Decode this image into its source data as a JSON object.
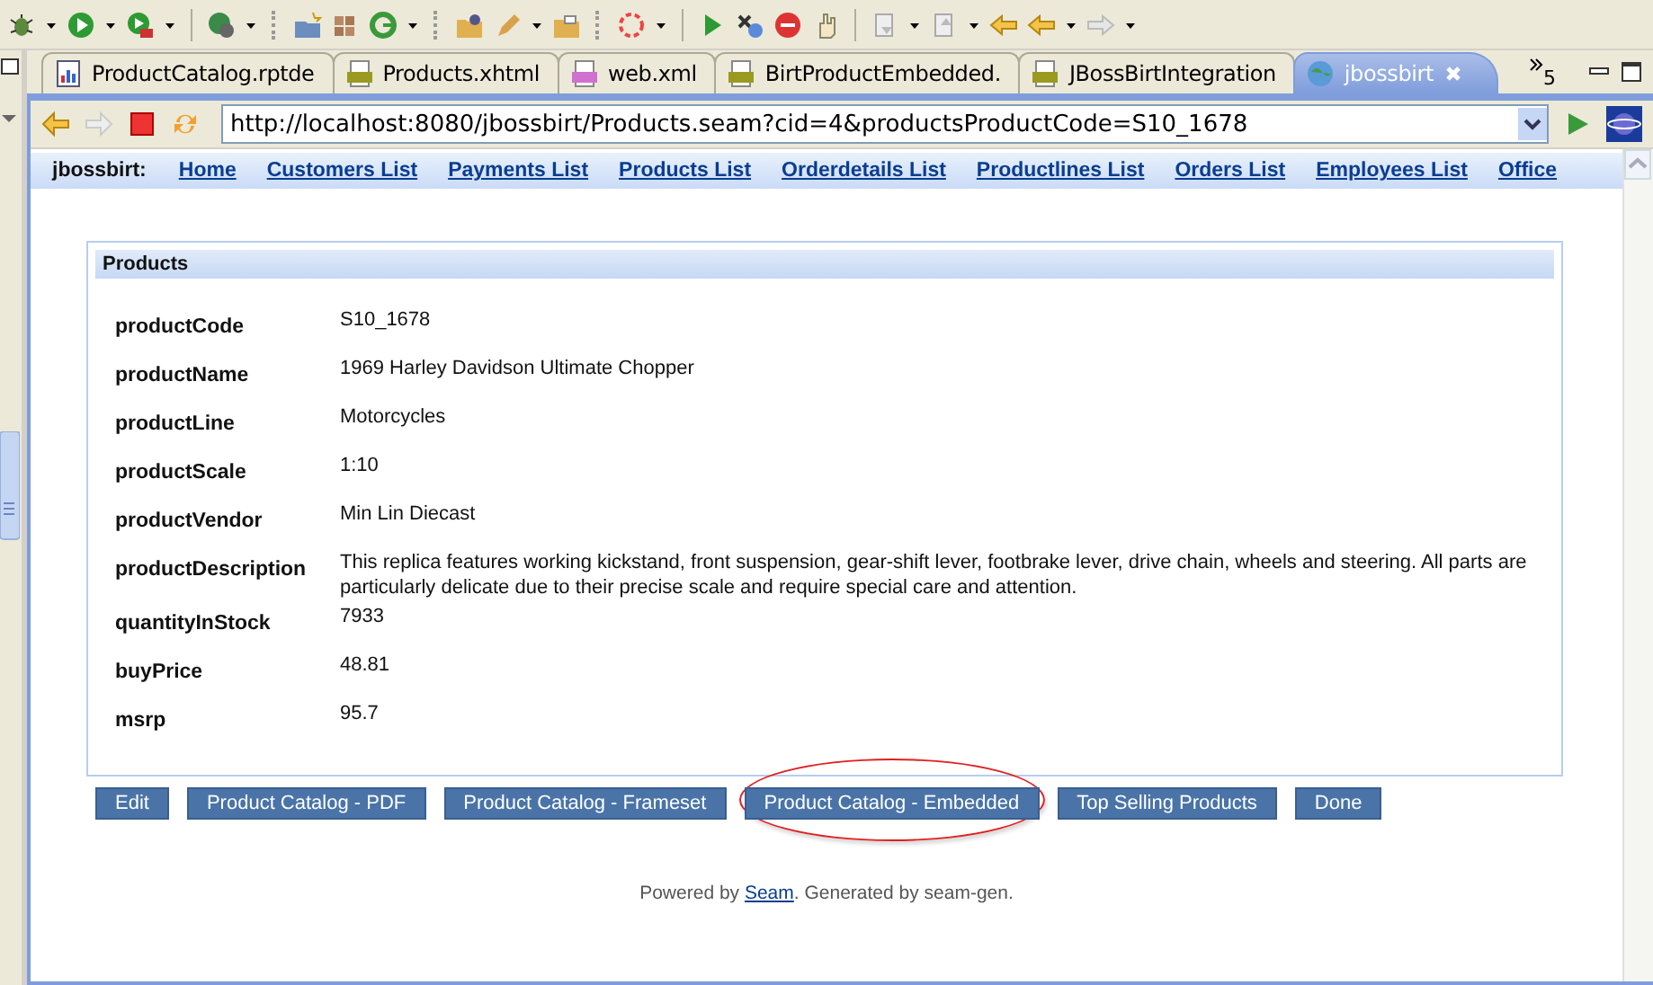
{
  "editor_tabs": [
    {
      "label": "ProductCatalog.rptde",
      "kind": "report",
      "selected": false
    },
    {
      "label": "Products.xhtml",
      "kind": "htm",
      "selected": false
    },
    {
      "label": "web.xml",
      "kind": "xml",
      "selected": false
    },
    {
      "label": "BirtProductEmbedded.",
      "kind": "htm",
      "selected": false
    },
    {
      "label": "JBossBirtIntegration",
      "kind": "htm",
      "selected": false
    },
    {
      "label": "jbossbirt",
      "kind": "web",
      "selected": true
    }
  ],
  "overflow_count": "5",
  "browser": {
    "url": "http://localhost:8080/jbossbirt/Products.seam?cid=4&productsProductCode=S10_1678",
    "forward_disabled": true
  },
  "nav": {
    "brand": "jbossbirt:",
    "links": [
      "Home",
      "Customers List",
      "Payments List",
      "Products List",
      "Orderdetails List",
      "Productlines List",
      "Orders List",
      "Employees List",
      "Office"
    ]
  },
  "panel": {
    "title": "Products",
    "fields": [
      {
        "label": "productCode",
        "value": "S10_1678"
      },
      {
        "label": "productName",
        "value": "1969 Harley Davidson Ultimate Chopper"
      },
      {
        "label": "productLine",
        "value": "Motorcycles"
      },
      {
        "label": "productScale",
        "value": "1:10"
      },
      {
        "label": "productVendor",
        "value": "Min Lin Diecast"
      },
      {
        "label": "productDescription",
        "value": "This replica features working kickstand, front suspension, gear-shift lever, footbrake lever, drive chain, wheels and steering. All parts are particularly delicate due to their precise scale and require special care and attention."
      },
      {
        "label": "quantityInStock",
        "value": "7933"
      },
      {
        "label": "buyPrice",
        "value": "48.81"
      },
      {
        "label": "msrp",
        "value": "95.7"
      }
    ]
  },
  "buttons": [
    {
      "label": "Edit",
      "highlighted": false
    },
    {
      "label": "Product Catalog - PDF",
      "highlighted": false
    },
    {
      "label": "Product Catalog - Frameset",
      "highlighted": false
    },
    {
      "label": "Product Catalog - Embedded",
      "highlighted": true
    },
    {
      "label": "Top Selling Products",
      "highlighted": false
    },
    {
      "label": "Done",
      "highlighted": false
    }
  ],
  "footer": {
    "before": "Powered by ",
    "link": "Seam",
    "after": ". Generated by seam-gen."
  }
}
